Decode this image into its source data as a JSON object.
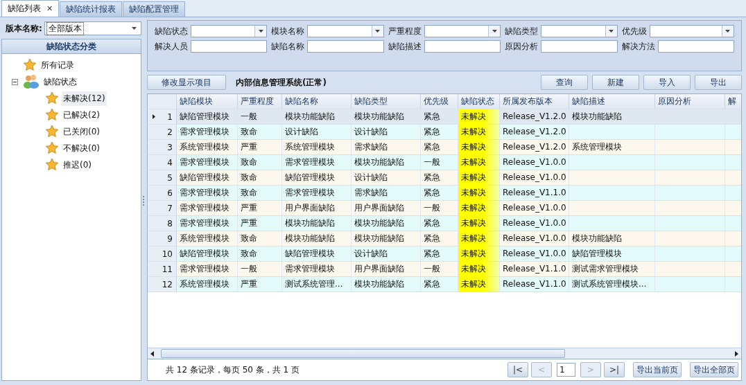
{
  "tabs": [
    {
      "label": "缺陷列表",
      "selected": true,
      "close": "✕"
    },
    {
      "label": "缺陷统计报表",
      "selected": false
    },
    {
      "label": "缺陷配置管理",
      "selected": false
    }
  ],
  "version": {
    "label": "版本名称:",
    "value": "全部版本"
  },
  "tree": {
    "title": "缺陷状态分类",
    "items": [
      {
        "label": "所有记录",
        "selected": false
      },
      {
        "label": "缺陷状态",
        "selected": false,
        "expanded": true,
        "children": [
          {
            "label": "未解决(12)",
            "selected": true
          },
          {
            "label": "已解决(2)",
            "selected": false
          },
          {
            "label": "已关闭(0)",
            "selected": false
          },
          {
            "label": "不解决(0)",
            "selected": false
          },
          {
            "label": "推迟(0)",
            "selected": false
          }
        ]
      }
    ]
  },
  "filters": [
    {
      "label": "缺陷状态",
      "kind": "combo"
    },
    {
      "label": "模块名称",
      "kind": "combo"
    },
    {
      "label": "严重程度",
      "kind": "combo"
    },
    {
      "label": "缺陷类型",
      "kind": "combo"
    },
    {
      "label": "优先级",
      "kind": "combo"
    },
    {
      "label": "解决人员",
      "kind": "text"
    },
    {
      "label": "缺陷名称",
      "kind": "text"
    },
    {
      "label": "缺陷描述",
      "kind": "text"
    },
    {
      "label": "原因分析",
      "kind": "text"
    },
    {
      "label": "解决方法",
      "kind": "text"
    }
  ],
  "toolbar": {
    "edit_button": "修改显示项目",
    "project": "内部信息管理系统(正常)",
    "buttons": [
      "查询",
      "新建",
      "导入",
      "导出"
    ]
  },
  "table": {
    "columns": [
      {
        "label": "缺陷模块",
        "kind": "text"
      },
      {
        "label": "严重程度",
        "kind": "text"
      },
      {
        "label": "缺陷名称",
        "kind": "text"
      },
      {
        "label": "缺陷类型",
        "kind": "text"
      },
      {
        "label": "优先级",
        "kind": "text"
      },
      {
        "label": "缺陷状态",
        "kind": "status"
      },
      {
        "label": "所属发布版本",
        "kind": "text"
      },
      {
        "label": "缺陷描述",
        "kind": "text"
      },
      {
        "label": "原因分析",
        "kind": "text"
      },
      {
        "label": "解",
        "kind": "cut"
      }
    ],
    "rows": [
      {
        "num": "1",
        "selected": true,
        "cells": [
          "缺陷管理模块",
          "一般",
          "模块功能缺陷",
          "模块功能缺陷",
          "紧急",
          "未解决",
          "Release_V1.2.0",
          "模块功能缺陷",
          "",
          ""
        ]
      },
      {
        "num": "2",
        "selected": false,
        "cells": [
          "需求管理模块",
          "致命",
          "设计缺陷",
          "设计缺陷",
          "紧急",
          "未解决",
          "Release_V1.2.0",
          "",
          "",
          ""
        ]
      },
      {
        "num": "3",
        "selected": false,
        "cells": [
          "系统管理模块",
          "严重",
          "系统管理模块",
          "需求缺陷",
          "紧急",
          "未解决",
          "Release_V1.2.0",
          "系统管理模块",
          "",
          ""
        ]
      },
      {
        "num": "4",
        "selected": false,
        "cells": [
          "需求管理模块",
          "致命",
          "需求管理模块",
          "模块功能缺陷",
          "一般",
          "未解决",
          "Release_V1.0.0",
          "",
          "",
          ""
        ]
      },
      {
        "num": "5",
        "selected": false,
        "cells": [
          "缺陷管理模块",
          "致命",
          "缺陷管理模块",
          "设计缺陷",
          "紧急",
          "未解决",
          "Release_V1.0.0",
          "",
          "",
          ""
        ]
      },
      {
        "num": "6",
        "selected": false,
        "cells": [
          "需求管理模块",
          "致命",
          "需求管理模块",
          "需求缺陷",
          "紧急",
          "未解决",
          "Release_V1.1.0",
          "",
          "",
          ""
        ]
      },
      {
        "num": "7",
        "selected": false,
        "cells": [
          "需求管理模块",
          "严重",
          "用户界面缺陷",
          "用户界面缺陷",
          "一般",
          "未解决",
          "Release_V1.0.0",
          "",
          "",
          ""
        ]
      },
      {
        "num": "8",
        "selected": false,
        "cells": [
          "需求管理模块",
          "严重",
          "模块功能缺陷",
          "模块功能缺陷",
          "紧急",
          "未解决",
          "Release_V1.0.0",
          "",
          "",
          ""
        ]
      },
      {
        "num": "9",
        "selected": false,
        "cells": [
          "系统管理模块",
          "致命",
          "模块功能缺陷",
          "模块功能缺陷",
          "紧急",
          "未解决",
          "Release_V1.0.0",
          "模块功能缺陷",
          "",
          ""
        ]
      },
      {
        "num": "10",
        "selected": false,
        "cells": [
          "缺陷管理模块",
          "致命",
          "缺陷管理模块",
          "设计缺陷",
          "紧急",
          "未解决",
          "Release_V1.0.0",
          "缺陷管理模块",
          "",
          ""
        ]
      },
      {
        "num": "11",
        "selected": false,
        "cells": [
          "需求管理模块",
          "一般",
          "需求管理模块",
          "用户界面缺陷",
          "一般",
          "未解决",
          "Release_V1.1.0",
          "测试需求管理模块",
          "",
          ""
        ]
      },
      {
        "num": "12",
        "selected": false,
        "cells": [
          "系统管理模块",
          "严重",
          "测试系统管理...",
          "模块功能缺陷",
          "紧急",
          "未解决",
          "Release_V1.1.0",
          "测试系统管理模块...",
          "",
          ""
        ]
      }
    ]
  },
  "footer": {
    "summary": "共 12 条记录，每页 50 条，共 1 页",
    "pager": [
      {
        "label": "|<",
        "disabled": false
      },
      {
        "label": "<",
        "disabled": true
      }
    ],
    "page": "1",
    "pager_after": [
      {
        "label": ">",
        "disabled": true
      },
      {
        "label": ">|",
        "disabled": false
      }
    ],
    "exports": [
      "导出当前页",
      "导出全部页"
    ]
  }
}
